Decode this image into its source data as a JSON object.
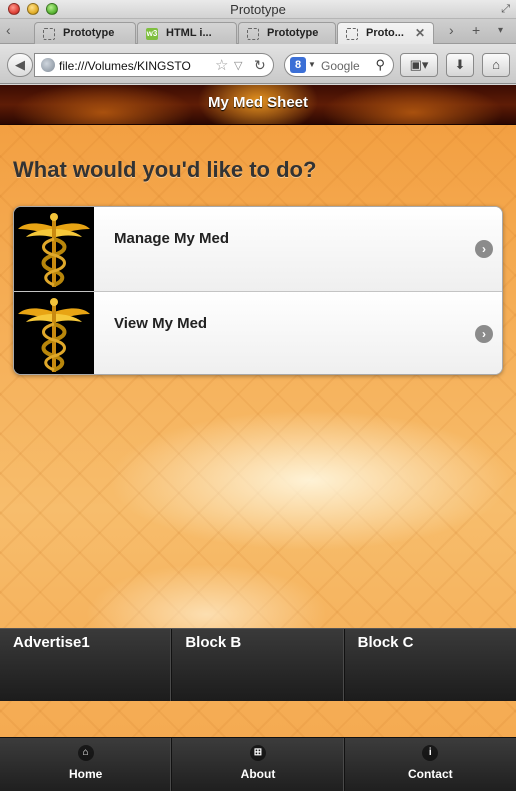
{
  "window": {
    "title": "Prototype"
  },
  "tabs": [
    {
      "label": "Prototype",
      "favicon": "blank-page-icon",
      "active": false
    },
    {
      "label": "HTML i...",
      "favicon": "w3-icon",
      "active": false
    },
    {
      "label": "Prototype",
      "favicon": "blank-page-icon",
      "active": false
    },
    {
      "label": "Proto...",
      "favicon": "blank-page-icon",
      "active": true
    }
  ],
  "toolbar": {
    "url": "file:///Volumes/KINGSTO",
    "search_engine_letter": "8",
    "search_placeholder": "Google"
  },
  "page": {
    "header_title": "My Med Sheet",
    "prompt": "What would you'd like to do?",
    "menu": [
      {
        "label": "Manage My Med",
        "icon": "caduceus-icon"
      },
      {
        "label": "View My Med",
        "icon": "caduceus-icon"
      }
    ],
    "blocks": [
      {
        "label": "Advertise1"
      },
      {
        "label": "Block B"
      },
      {
        "label": "Block C"
      }
    ],
    "nav": [
      {
        "label": "Home",
        "icon": "home-icon"
      },
      {
        "label": "About",
        "icon": "grid-icon"
      },
      {
        "label": "Contact",
        "icon": "info-icon"
      }
    ]
  },
  "colors": {
    "header_dark": "#3b0c03",
    "page_orange": "#f6b25c",
    "footer_dark": "#1f1f1f",
    "title_text": "#333333"
  }
}
